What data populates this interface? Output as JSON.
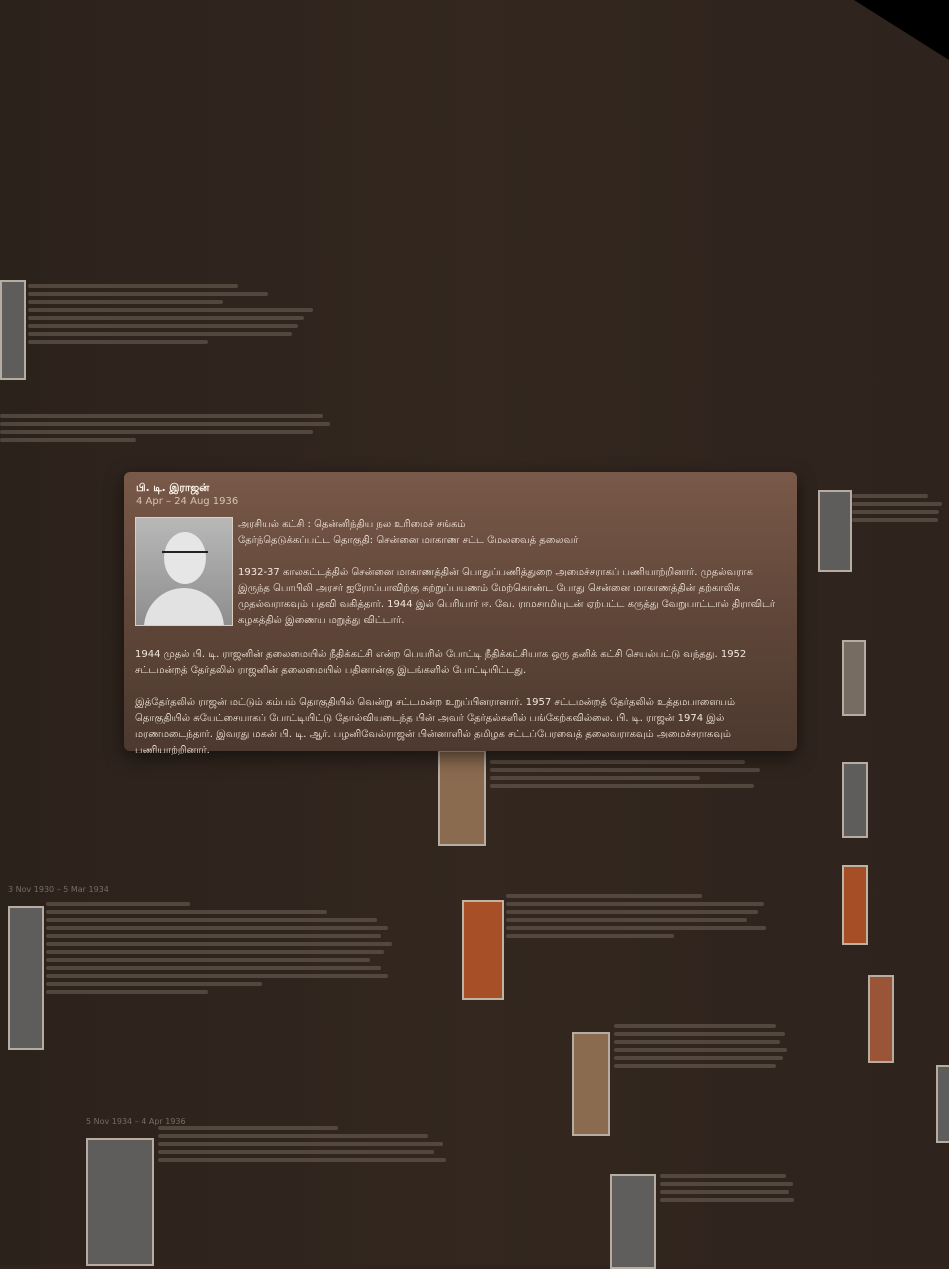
{
  "tooltip": {
    "name": "பி. டி. இராஜன்",
    "dates": "4 Apr – 24 Aug 1936",
    "party": "அரசியல் கட்சி : தென்னிந்திய நல உரிமைச் சங்கம்",
    "constituency": "தேர்ந்தெடுக்கப்பட்ட தொகுதி: சென்னை மாகாண சட்ட மேலவைத் தலைவர்",
    "para1": "1932-37 காலகட்டத்தில் சென்னை மாகாணத்தின் பொதுப்பணித்துறை அமைச்சராகப் பணியாற்றினார். முதல்வராக இருந்த பொபிலி அரசர் ஐரோப்பாவிற்கு சுற்றுப்பயணம் மேற்கொண்ட போது சென்னை மாகாணத்தின் தற்காலிக முதல்வராகவும் பதவி வகித்தார். 1944 இல் பெரியார் ஈ. வே. ராமசாமியுடன் ஏற்பட்ட கருத்து வேறுபாட்டால் திராவிடர் கழகத்தில் இணைய மறுத்து விட்டார்.",
    "para2": "1944 முதல் பி. டி. ராஜனின் தலைமையில் நீதிக்கட்சி என்ற பெயரில் போட்டி நீதிக்கட்சியாக ஒரு தனிக் கட்சி செயல்பட்டு வந்தது. 1952 சட்டமன்றத் தேர்தலில் ராஜனின் தலைமையில் பதினான்கு இடங்களில் போட்டியிட்டது.",
    "para3": "இத்தேர்தலில் ராஜன் மட்டும் கம்பம் தொகுதியில் வென்று சட்டமன்ற உறுப்பினரானார். 1957 சட்டமன்றத் தேர்தலில் உத்தமபாளையம் தொகுதியில் சுயேட்சையாகப் போட்டியிட்டு தோல்வியடைந்த பின் அவர் தேர்தல்களில் பங்கேற்கவில்லை. பி. டி. ராஜன் 1974 இல் மரணமடைந்தார். இவரது மகன் பி. டி. ஆர். பழனிவேல்ராஜன் பின்னாளில் தமிழக சட்டப்பேரவைத் தலைவராகவும் அமைச்சராகவும் பணியாற்றினார்."
  },
  "background_panels": [
    {
      "title": "",
      "dates": "3 Nov 1930 – 5 Mar 1934"
    },
    {
      "title": "",
      "dates": "5 Nov 1934 – 4 Apr 1936"
    },
    {
      "title": "",
      "dates": ""
    },
    {
      "title": "",
      "dates": ""
    }
  ],
  "colors": {
    "background": "#2f241e",
    "tooltip": "#6a4e40",
    "text": "#f3e8dd"
  }
}
